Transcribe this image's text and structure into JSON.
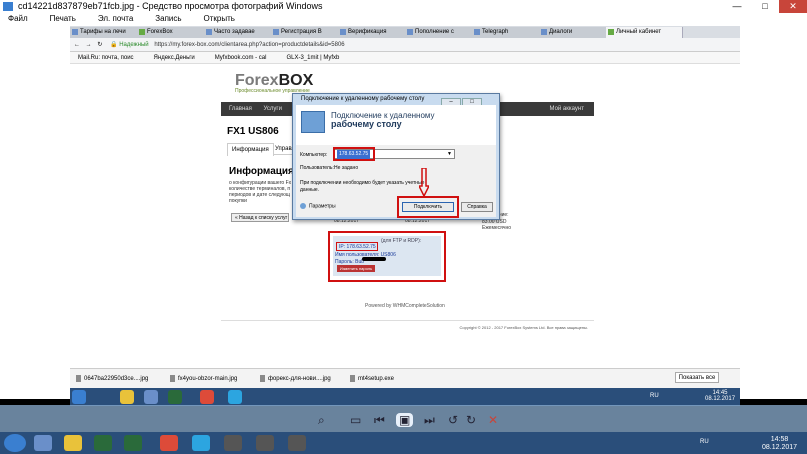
{
  "viewer": {
    "title": "cd14221d837879eb71fcb.jpg - Средство просмотра фотографий Windows",
    "menu": [
      "Файл",
      "Печать",
      "Эл. почта",
      "Запись",
      "Открыть"
    ]
  },
  "browser": {
    "tabs": [
      "Тарифы на лечи",
      "ForexBox",
      "Часто задавае",
      "Регистрация В",
      "Верификация",
      "Пополнение с",
      "Telegraph",
      "Диалоги",
      "Личный кабинет"
    ],
    "address": {
      "secure_label": "Надежный",
      "url": "https://my.forex-box.com/clientarea.php?action=productdetails&id=5806"
    },
    "bookmarks": [
      "Mail.Ru: почта, поис",
      "Яндекс.Деньги",
      "Myfxbook.com - cal",
      "GLX-3_1mit | Myfxb"
    ]
  },
  "site": {
    "logo_main": "Forex",
    "logo_bold": "BOX",
    "logo_sub": "Профессиональное управление",
    "nav": [
      "Главная",
      "Услуги"
    ],
    "nav_right": "Мой аккаунт",
    "product_title": "FX1 US806",
    "tabs": [
      "Информация",
      "Управл"
    ],
    "info_title": "Информация",
    "info_text": "о конфигурации вашего Fx количестве терминалов, п периодов и дате следующ покупки",
    "back_button": "« Назад к списку услуг",
    "stats_left": "08.12.2017",
    "stats_mid": "08.12.2017",
    "stats_right_label": "здолжение:",
    "stats_right_value": "83.00 USD Ежемесячно",
    "creds_header": "(для FTP и RDP):",
    "ip_label": "IP: 178.63.52.75",
    "user_label": "Имя пользователя: US806",
    "password_label": "Пароль: Bub",
    "change_password": "Изменить пароль",
    "powered": "Powered by WHMCompleteSolution",
    "footer": "Copyright © 2012 - 2017 ForexBox Systems Ltd. Все права защищены."
  },
  "rdp": {
    "window_title": "Подключение к удаленному рабочему столу",
    "heading_line1": "Подключение к удаленному",
    "heading_line2": "рабочему столу",
    "computer_label": "Компьютер:",
    "computer_value": "178.63.52.75",
    "user_label": "Пользователь:",
    "user_value": "Не задано",
    "note": "При подключении необходимо будет указать учетные данные.",
    "params": "Параметры",
    "connect": "Подключить",
    "help": "Справка"
  },
  "downloads": {
    "items": [
      "0647ba22950d3ce....jpg",
      "fx4you-obzor-main.jpg",
      "форекс-для-нови....jpg",
      "mt4setup.exe"
    ],
    "show_all": "Показать все"
  },
  "inner_tray": {
    "lang": "RU",
    "time": "14:45",
    "date": "08.12.2017"
  },
  "taskbar": {
    "lang": "RU",
    "time": "14:58",
    "date": "08.12.2017"
  }
}
